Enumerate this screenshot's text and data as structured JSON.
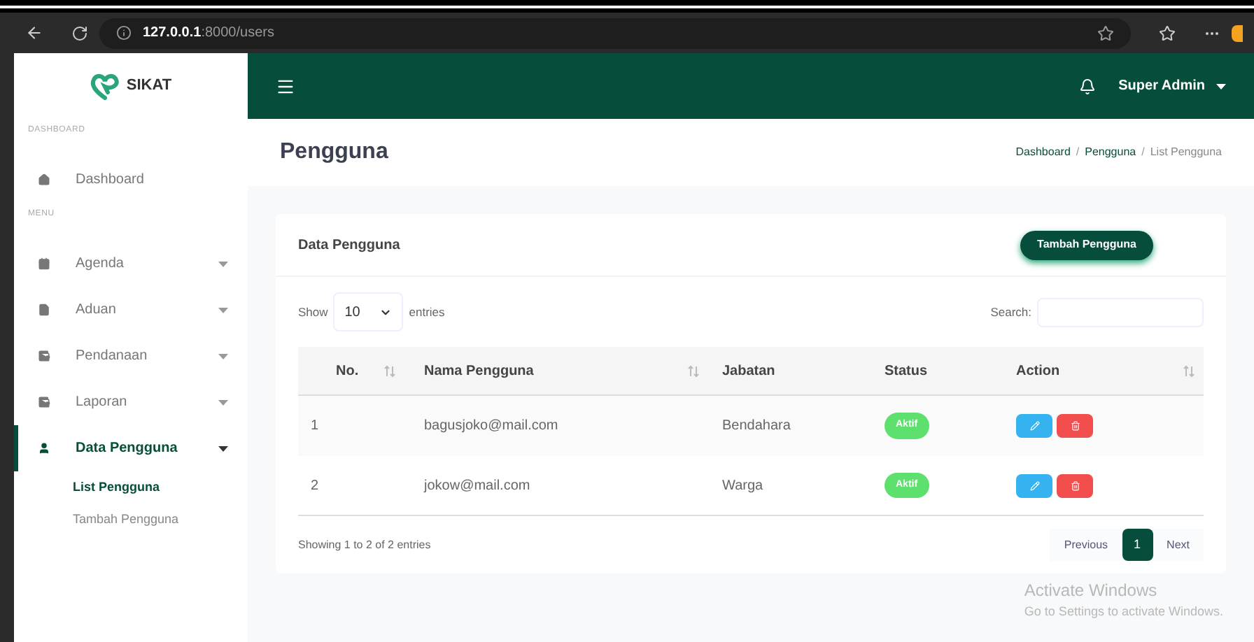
{
  "browser": {
    "address": "**127.0.0.1**:8000/users"
  },
  "sidebar": {
    "brand": "SIKAT",
    "sections": [
      {
        "title": "DASHBOARD",
        "items": [
          {
            "label": "Dashboard",
            "kind": "link",
            "selected": false
          }
        ]
      },
      {
        "title": "MENU",
        "items": [
          {
            "label": "Agenda",
            "kind": "dropdown",
            "selected": false,
            "expanded": false
          },
          {
            "label": "Aduan",
            "kind": "dropdown",
            "selected": false,
            "expanded": false
          },
          {
            "label": "Pendanaan",
            "kind": "dropdown",
            "selected": false,
            "expanded": false
          },
          {
            "label": "Laporan",
            "kind": "dropdown",
            "selected": false,
            "expanded": false
          },
          {
            "label": "Data Pengguna",
            "kind": "dropdown",
            "selected": true,
            "expanded": true,
            "children": [
              {
                "label": "List Pengguna",
                "selected": true
              },
              {
                "label": "Tambah Pengguna",
                "selected": false
              }
            ]
          }
        ]
      }
    ]
  },
  "topbar": {
    "user": "Super Admin"
  },
  "page": {
    "title": "Pengguna",
    "breadcrumb": [
      {
        "label": "Dashboard",
        "selected": false
      },
      {
        "separator": "/"
      },
      {
        "label": "Pengguna",
        "selected": false
      },
      {
        "separator": "/"
      },
      {
        "label": "List Pengguna",
        "selected": true
      }
    ]
  },
  "card": {
    "title": "Data Pengguna",
    "add_button": "Tambah Pengguna",
    "show_label": "Show",
    "page_size": "10",
    "entries_label": "entries",
    "search_label": "Search:",
    "table": {
      "columns": [
        {
          "label": "No.",
          "sortable": true
        },
        {
          "label": "Nama Pengguna",
          "sortable": true
        },
        {
          "label": "Jabatan",
          "sortable": false
        },
        {
          "label": "Status",
          "sortable": false
        },
        {
          "label": "Action",
          "sortable": true
        }
      ],
      "rows": [
        {
          "no": "1",
          "email": "bagusjoko@mail.com",
          "jabatan": "Bendahara",
          "status": "Aktif"
        },
        {
          "no": "2",
          "email": "jokow@mail.com",
          "jabatan": "Warga",
          "status": "Aktif"
        }
      ]
    },
    "info": "Showing 1 to 2 of 2 entries",
    "pagination": {
      "previous": "Previous",
      "pages": [
        {
          "label": "1",
          "selected": true
        }
      ],
      "next": "Next"
    }
  },
  "os_notice": {
    "title": "Activate Windows",
    "text": "Go to Settings to activate Windows."
  }
}
